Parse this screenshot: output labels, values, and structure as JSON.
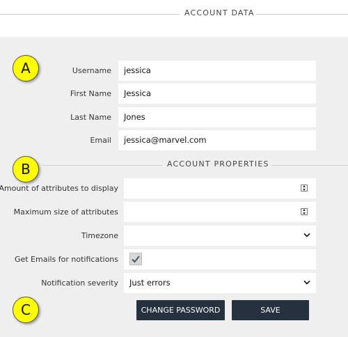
{
  "account_data": {
    "title": "ACCOUNT DATA"
  },
  "markers": {
    "a": "A",
    "b": "B",
    "c": "C"
  },
  "account_fields": {
    "username": {
      "label": "Username",
      "value": "jessica"
    },
    "first_name": {
      "label": "First Name",
      "value": "Jessica"
    },
    "last_name": {
      "label": "Last Name",
      "value": "Jones"
    },
    "email": {
      "label": "Email",
      "value": "jessica@marvel.com"
    }
  },
  "account_properties": {
    "title": "ACCOUNT PROPERTIES",
    "attributes_amount": {
      "label": "Amount of attributes to display",
      "value": ""
    },
    "attributes_max_size": {
      "label": "Maximum size of attributes",
      "value": ""
    },
    "timezone": {
      "label": "Timezone",
      "value": ""
    },
    "email_notifications": {
      "label": "Get Emails for notifications",
      "checked": true
    },
    "notification_severity": {
      "label": "Notification severity",
      "value": "Just errors"
    }
  },
  "buttons": {
    "change_password": "CHANGE PASSWORD",
    "save": "SAVE"
  },
  "colors": {
    "marker": "#ffff00",
    "button_bg": "#263140",
    "panel_bg": "#efefef"
  },
  "icons": {
    "spinner": "spinner-arrows-icon",
    "dropdown": "chevron-down-icon",
    "check": "checkmark-icon"
  }
}
